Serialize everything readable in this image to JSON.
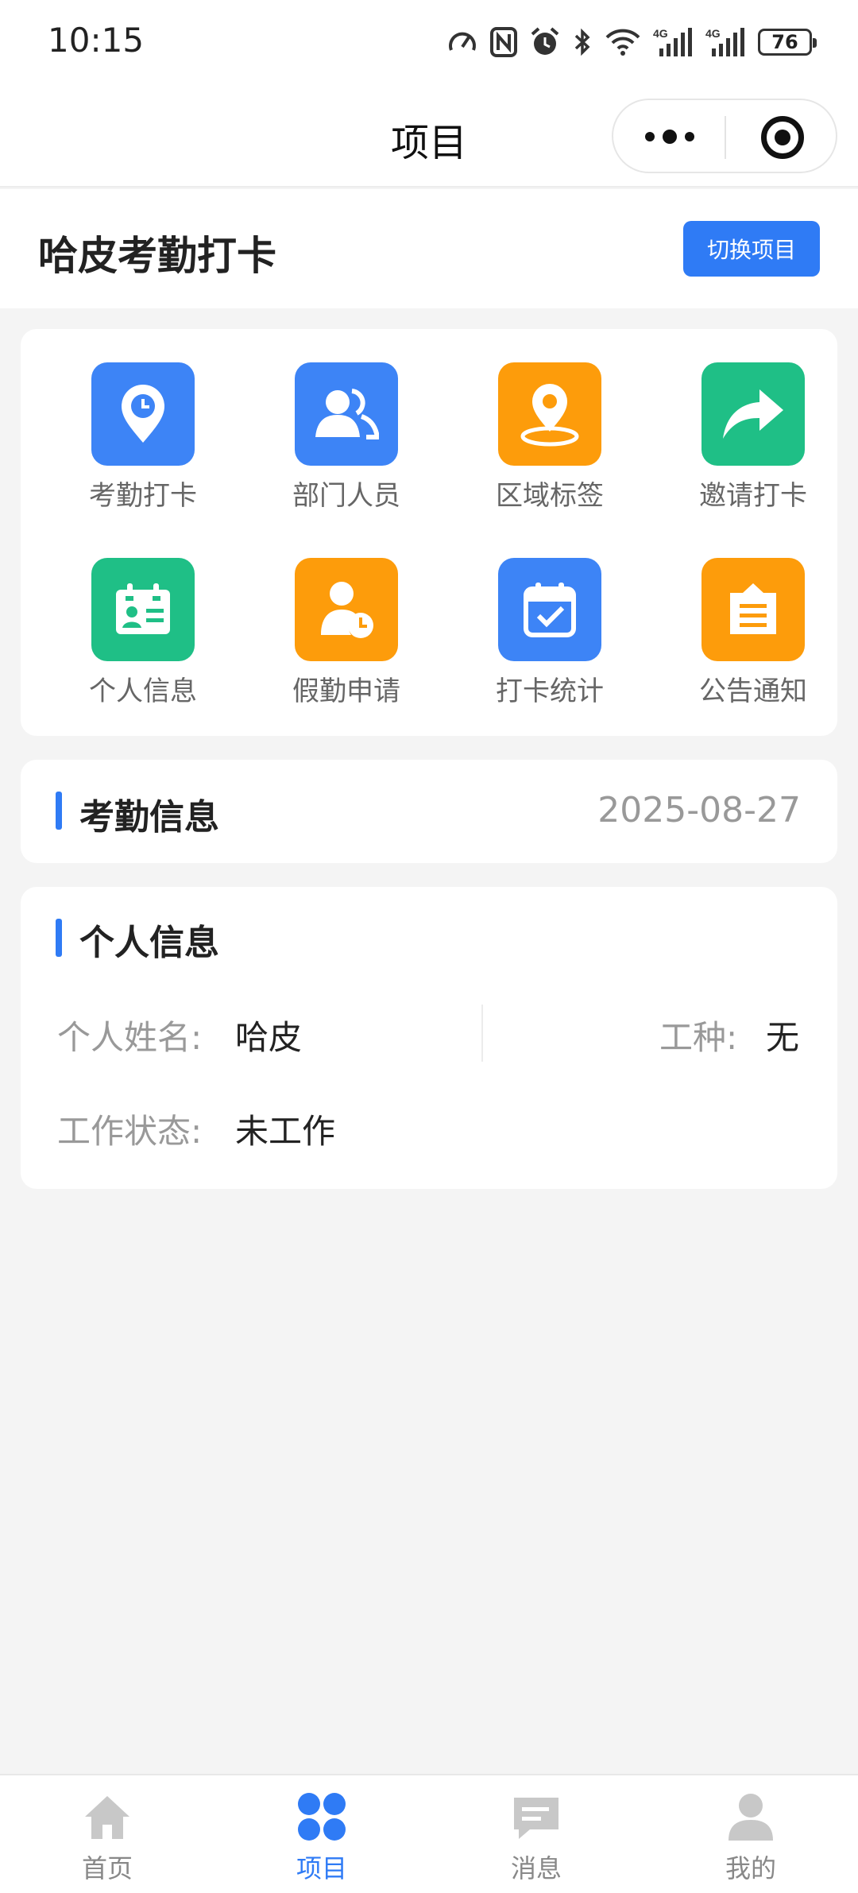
{
  "status_bar": {
    "time": "10:15",
    "battery": "76",
    "icons": [
      "speedometer-icon",
      "nfc-icon",
      "alarm-icon",
      "bluetooth-icon",
      "wifi-icon",
      "signal-4g-icon",
      "signal-4g-icon"
    ]
  },
  "nav": {
    "title": "项目"
  },
  "project": {
    "name": "哈皮考勤打卡",
    "switch_label": "切换项目"
  },
  "grid": [
    {
      "label": "考勤打卡",
      "icon": "location-clock-icon",
      "color": "#3d84f6"
    },
    {
      "label": "部门人员",
      "icon": "people-icon",
      "color": "#3d84f6"
    },
    {
      "label": "区域标签",
      "icon": "map-pin-icon",
      "color": "#fd9c0b"
    },
    {
      "label": "邀请打卡",
      "icon": "share-arrow-icon",
      "color": "#1fbf86"
    },
    {
      "label": "个人信息",
      "icon": "id-card-icon",
      "color": "#1fbf86"
    },
    {
      "label": "假勤申请",
      "icon": "person-clock-icon",
      "color": "#fd9c0b"
    },
    {
      "label": "打卡统计",
      "icon": "calendar-check-icon",
      "color": "#3d84f6"
    },
    {
      "label": "公告通知",
      "icon": "notice-board-icon",
      "color": "#fd9c0b"
    }
  ],
  "attendance": {
    "title": "考勤信息",
    "date": "2025-08-27"
  },
  "personal": {
    "title": "个人信息",
    "name_label": "个人姓名:",
    "name_value": "哈皮",
    "job_label": "工种:",
    "job_value": "无",
    "status_label": "工作状态:",
    "status_value": "未工作"
  },
  "tabs": [
    {
      "label": "首页",
      "icon": "home-icon",
      "active": false
    },
    {
      "label": "项目",
      "icon": "grid-clover-icon",
      "active": true
    },
    {
      "label": "消息",
      "icon": "message-icon",
      "active": false
    },
    {
      "label": "我的",
      "icon": "user-icon",
      "active": false
    }
  ],
  "colors": {
    "accent": "#2f7bf5",
    "tab_inactive": "#c8c8c8"
  }
}
